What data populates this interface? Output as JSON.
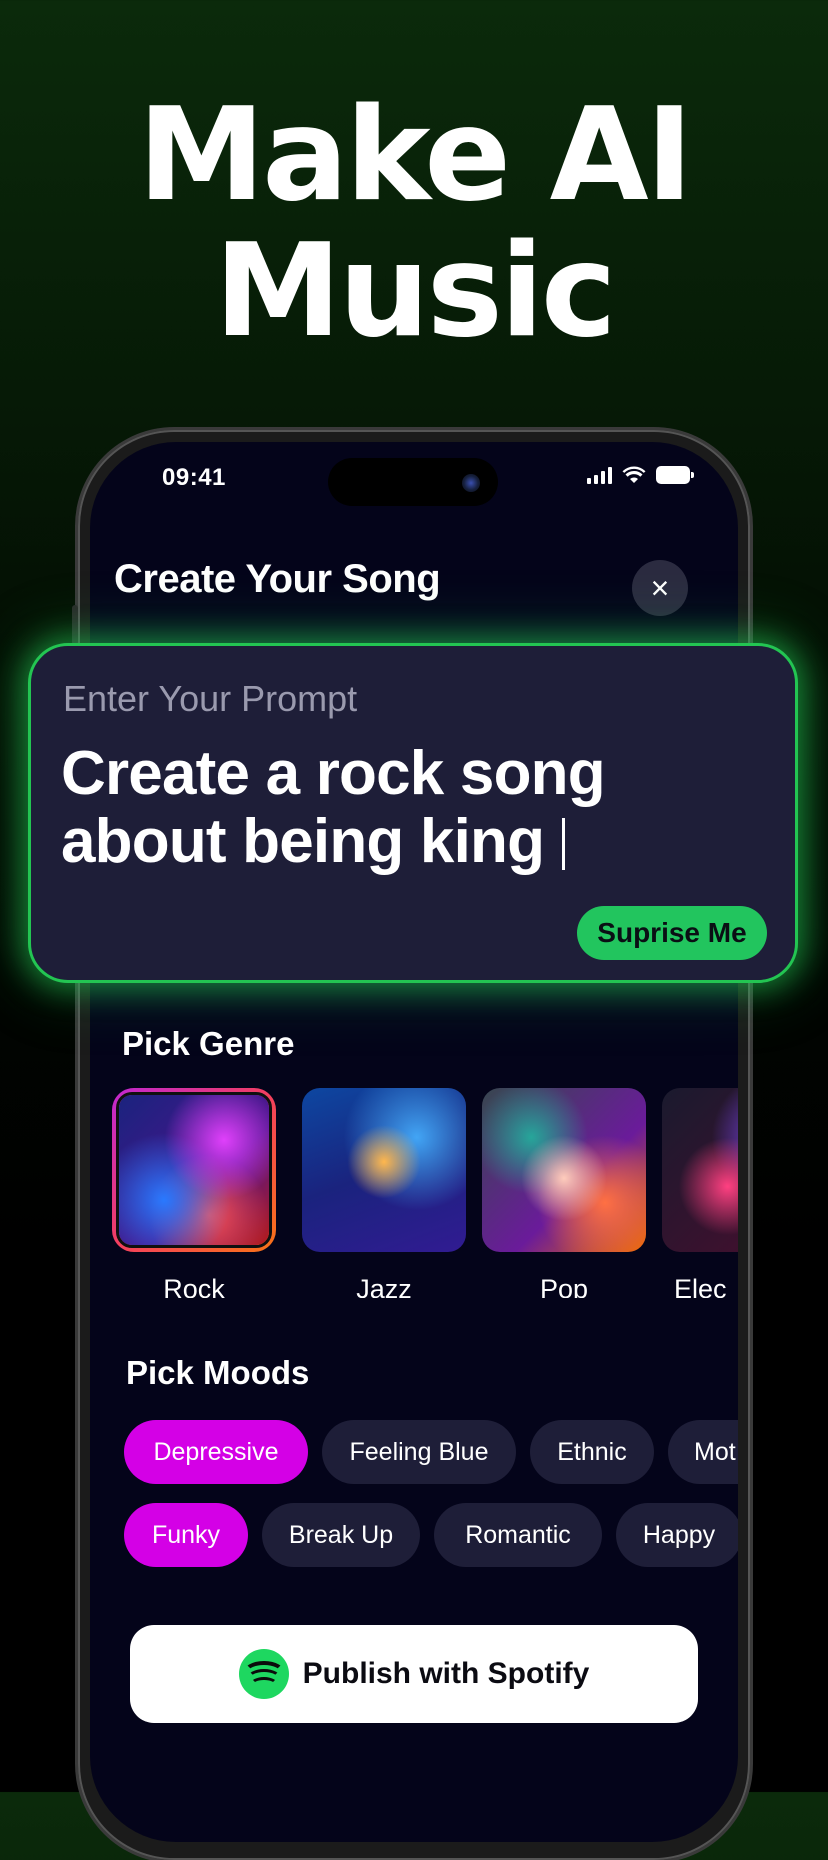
{
  "headline": {
    "line1": "Make AI",
    "line2": "Music"
  },
  "status_bar": {
    "time": "09:41"
  },
  "screen": {
    "title": "Create Your Song",
    "close_icon": "×"
  },
  "prompt": {
    "label": "Enter Your Prompt",
    "text": "Create a rock song about being king",
    "surprise_label": "Suprise Me"
  },
  "genres": {
    "title": "Pick Genre",
    "items": [
      {
        "label": "Rock",
        "selected": true
      },
      {
        "label": "Jazz",
        "selected": false
      },
      {
        "label": "Pop",
        "selected": false
      },
      {
        "label": "Elec",
        "selected": false
      }
    ]
  },
  "moods": {
    "title": "Pick Moods",
    "row1": [
      {
        "label": "Depressive",
        "active": true
      },
      {
        "label": "Feeling Blue",
        "active": false
      },
      {
        "label": "Ethnic",
        "active": false
      },
      {
        "label": "Mot",
        "active": false
      }
    ],
    "row2": [
      {
        "label": "Funky",
        "active": true
      },
      {
        "label": "Break Up",
        "active": false
      },
      {
        "label": "Romantic",
        "active": false
      },
      {
        "label": "Happy",
        "active": false
      }
    ]
  },
  "publish": {
    "label": "Publish with Spotify",
    "icon": "spotify-icon"
  },
  "colors": {
    "accent_green": "#22c55e",
    "mood_active": "#d400e6",
    "card_bg": "#1e1e38"
  }
}
